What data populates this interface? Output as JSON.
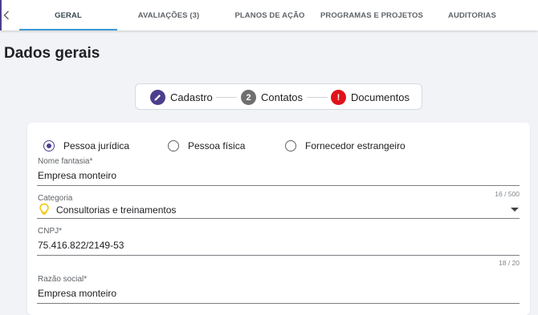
{
  "tabs": [
    {
      "label": "GERAL",
      "active": true
    },
    {
      "label": "AVALIAÇÕES (3)",
      "active": false
    },
    {
      "label": "PLANOS DE AÇÃO",
      "active": false
    },
    {
      "label": "PROGRAMAS E PROJETOS",
      "active": false
    },
    {
      "label": "AUDITORIAS",
      "active": false
    }
  ],
  "page_title": "Dados gerais",
  "stepper": {
    "steps": [
      {
        "label": "Cadastro",
        "icon": "pencil-icon",
        "color": "#4a3f8c"
      },
      {
        "label": "Contatos",
        "badge": "2",
        "color": "#6f6f6f"
      },
      {
        "label": "Documentos",
        "badge": "!",
        "color": "#e0121b"
      }
    ]
  },
  "person_type": {
    "options": [
      "Pessoa jurídica",
      "Pessoa física",
      "Fornecedor estrangeiro"
    ],
    "selected": "Pessoa jurídica"
  },
  "fields": {
    "nome_fantasia": {
      "label": "Nome fantasia*",
      "value": "Empresa monteiro",
      "counter": "16 / 500"
    },
    "categoria": {
      "label": "Categoria",
      "value": "Consultorias e treinamentos",
      "icon": "lightbulb-icon"
    },
    "cnpj": {
      "label": "CNPJ*",
      "value": "75.416.822/2149-53",
      "counter": "18 / 20"
    },
    "razao_social": {
      "label": "Razão social*",
      "value": "Empresa monteiro"
    }
  },
  "colors": {
    "accent": "#4a3f8c",
    "tab_indicator": "#3f9bd6",
    "error": "#e0121b",
    "warning_icon": "#f2c300"
  }
}
